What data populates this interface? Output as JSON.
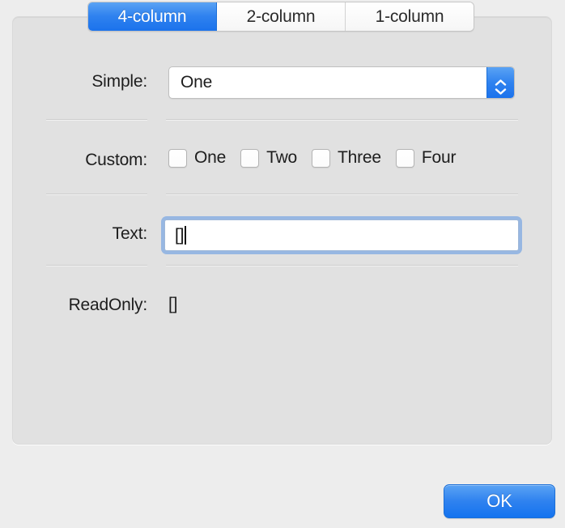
{
  "window": {
    "background_color": "#ededed",
    "panel_color": "#e1e1e1",
    "accent_color": "#2f82ef"
  },
  "tabs": {
    "selected_index": 0,
    "items": [
      {
        "label": "4-column",
        "selected": true
      },
      {
        "label": "2-column",
        "selected": false
      },
      {
        "label": "1-column",
        "selected": false
      }
    ]
  },
  "form": {
    "simple": {
      "label": "Simple:",
      "value": "One",
      "options": [
        "One"
      ],
      "stepper_up_icon": "chevron-up-icon",
      "stepper_down_icon": "chevron-down-icon"
    },
    "custom": {
      "label": "Custom:",
      "checkboxes": [
        {
          "label": "One",
          "checked": false
        },
        {
          "label": "Two",
          "checked": false
        },
        {
          "label": "Three",
          "checked": false
        },
        {
          "label": "Four",
          "checked": false
        }
      ]
    },
    "text": {
      "label": "Text:",
      "value": "[]",
      "placeholder": "",
      "focused": true
    },
    "readonly": {
      "label": "ReadOnly:",
      "value": "[]"
    }
  },
  "footer": {
    "ok_label": "OK"
  }
}
